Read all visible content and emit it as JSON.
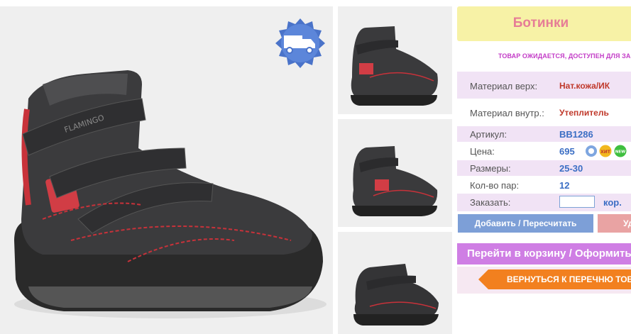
{
  "product": {
    "title": "Ботинки",
    "availability_notice": "ТОВАР ОЖИДАЕТСЯ, ДОСТУПЕН ДЛЯ ЗАКАЗА",
    "main_image_icon": "boot-photo",
    "delivery_badge_icon": "truck-icon",
    "thumbnails": [
      "boot-photo-side",
      "boot-photo-three-quarter",
      "boot-photo-back"
    ]
  },
  "specs": {
    "material_upper": {
      "label": "Материал верх:",
      "value": "Нат.кожа/ИК"
    },
    "material_inner": {
      "label": "Материал внутр.:",
      "value": "Утеплитель"
    },
    "article": {
      "label": "Артикул:",
      "value": "BB1286"
    },
    "price": {
      "label": "Цена:",
      "value": "695",
      "badges": [
        "sale-icon",
        "ХИТ",
        "NEW"
      ]
    },
    "sizes": {
      "label": "Размеры:",
      "value": "25-30"
    },
    "pairs": {
      "label": "Кол-во пар:",
      "value": "12"
    },
    "order": {
      "label": "Заказать:",
      "input_value": "",
      "unit": "кор."
    }
  },
  "buttons": {
    "add": "Добавить / Пересчитать",
    "delete": "Удалить",
    "cart": "Перейти в корзину / Оформить заказ",
    "back": "ВЕРНУТЬСЯ К ПЕРЕЧНЮ ТОВАРОВ"
  },
  "colors": {
    "title_bg": "#f7f2a6",
    "title_text": "#e67d96",
    "notice_text": "#c33cc7",
    "row_shade": "#f1e3f5",
    "accent_blue": "#3b6ec4",
    "add_button": "#7d9fd7",
    "cart_button": "#cf7ee4",
    "back_button": "#f2801f"
  }
}
